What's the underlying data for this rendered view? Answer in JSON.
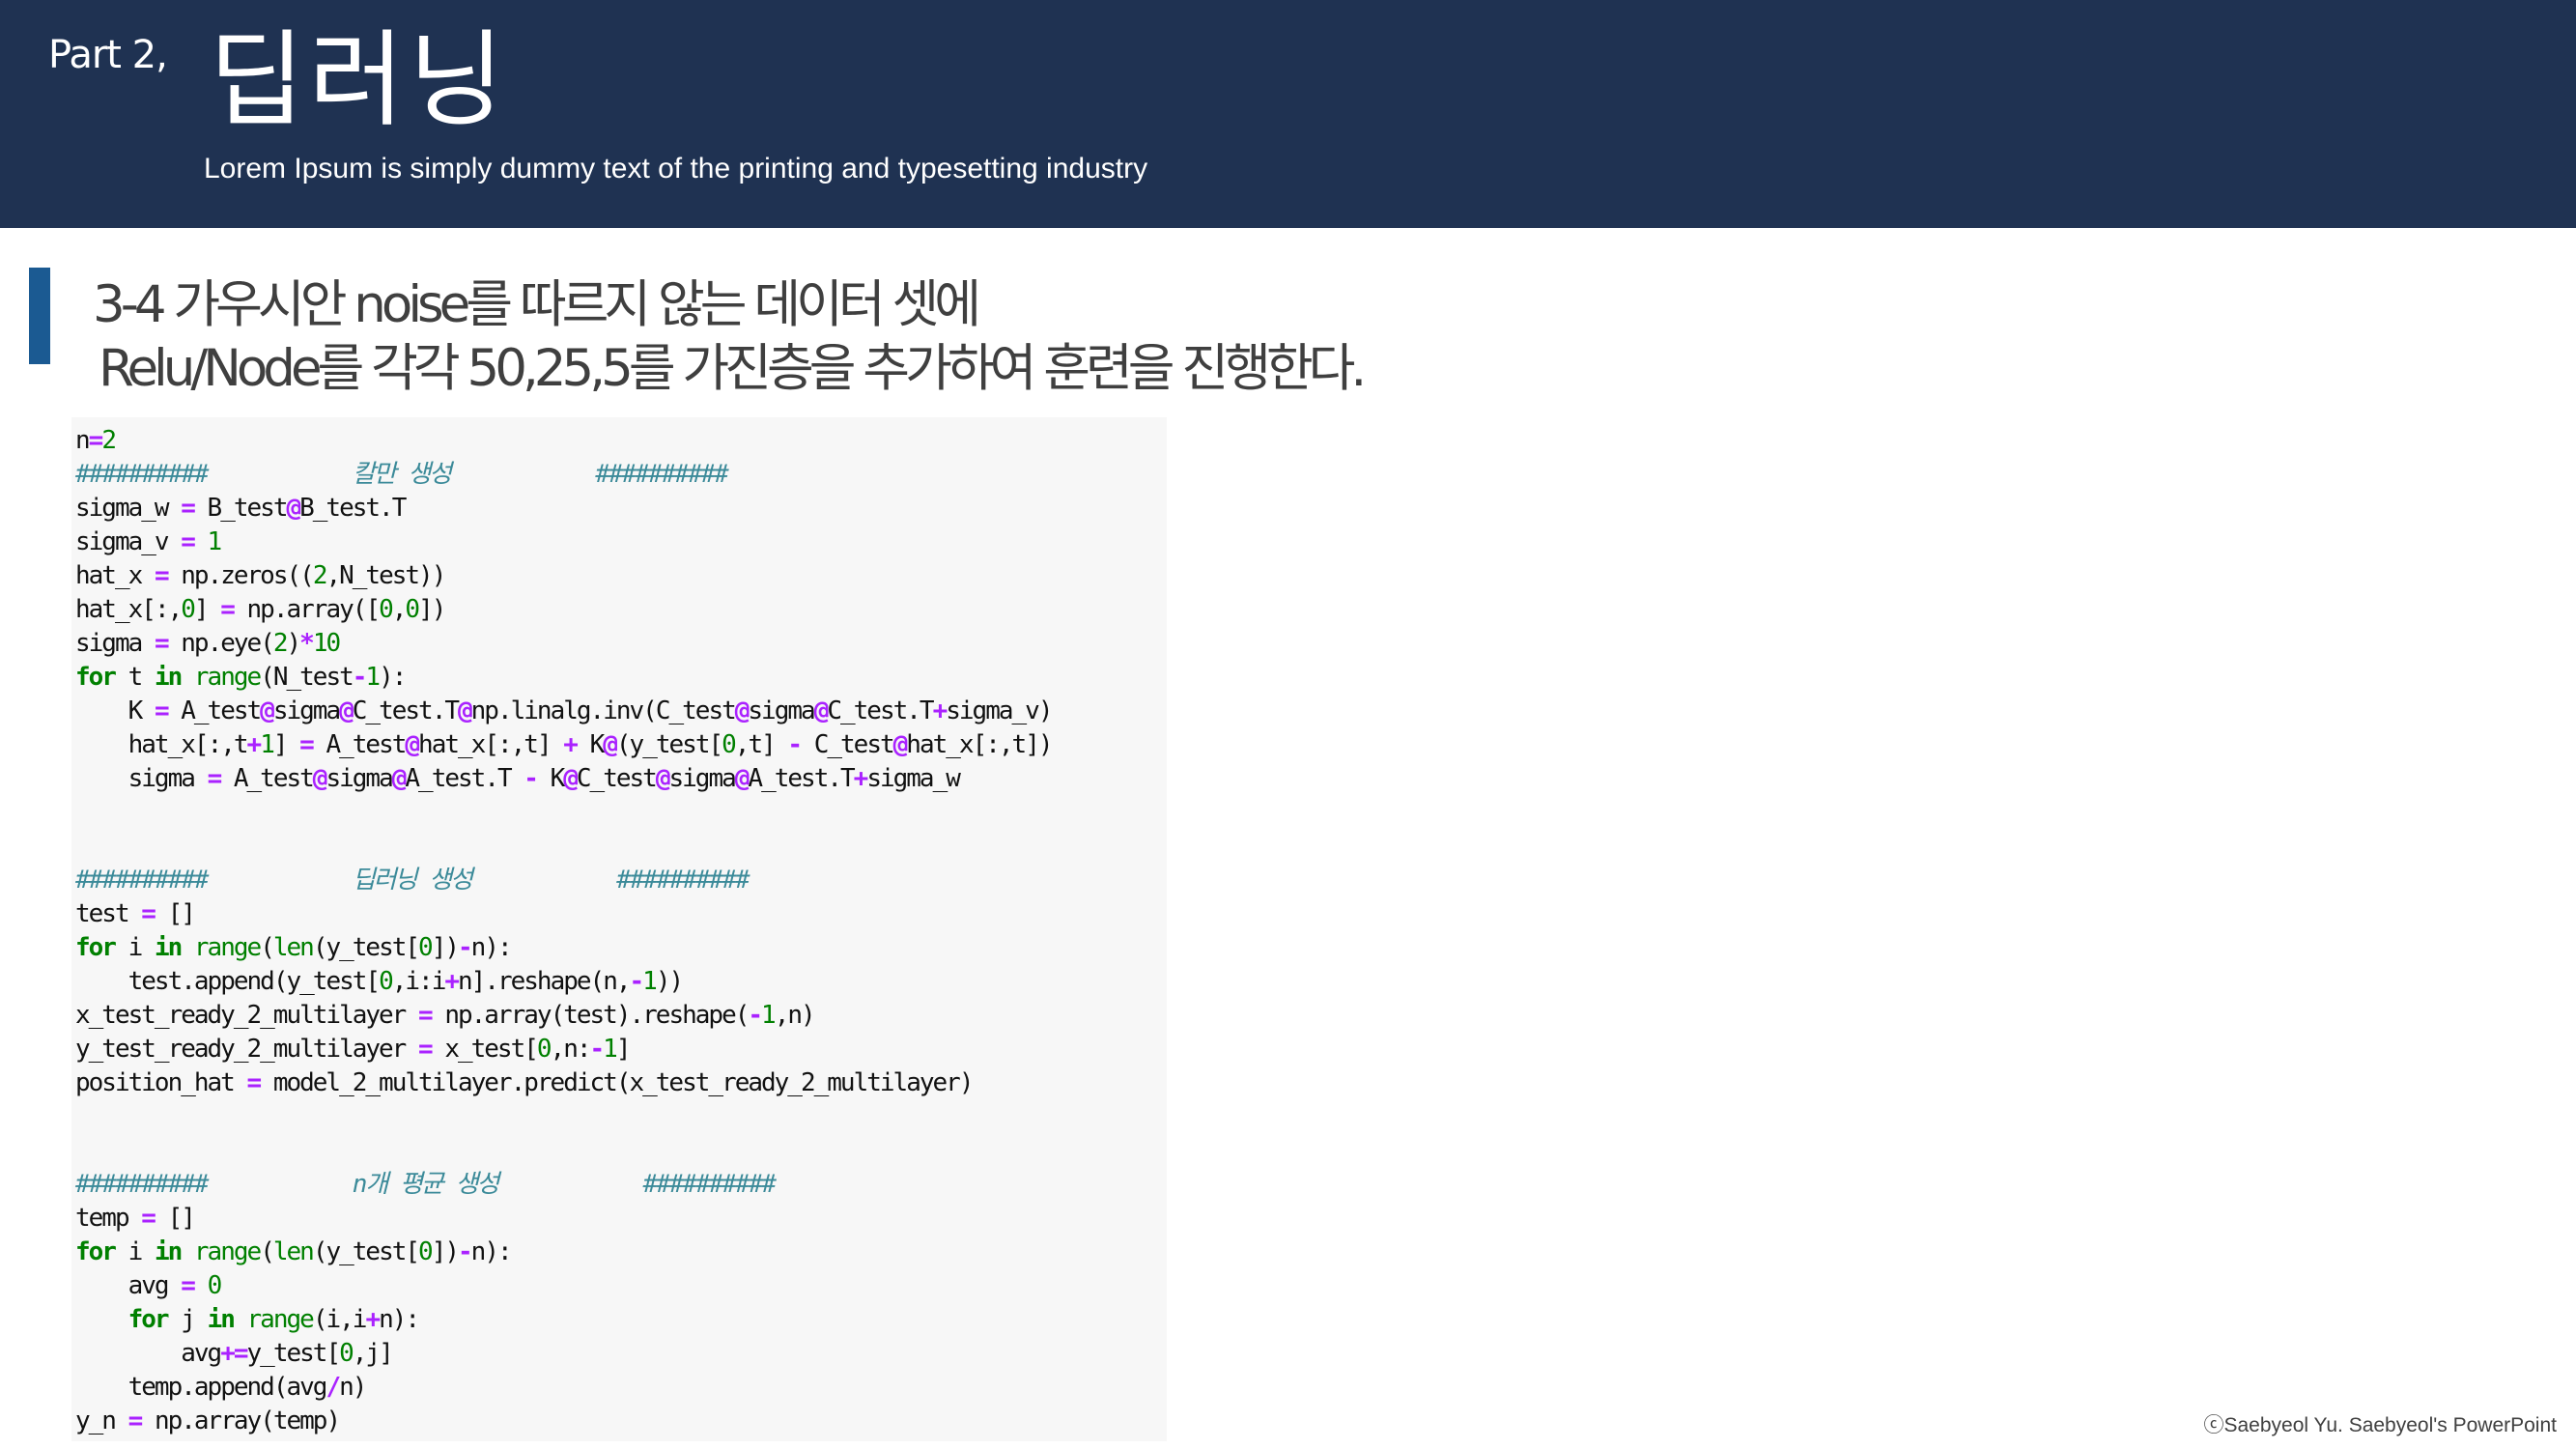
{
  "header": {
    "part_label": "Part 2,",
    "title": "딥러닝",
    "subtitle": "Lorem Ipsum is simply dummy text of the printing and typesetting industry"
  },
  "colors": {
    "header_bg": "#1f3252",
    "accent_bar": "#1b5a92",
    "code_bg": "#f7f7f7",
    "keyword": "#008000",
    "operator": "#aa22ff",
    "comment": "#3b8a99"
  },
  "heading": {
    "line1": "3-4 가우시안 noise를 따르지 않는 데이터 셋에",
    "line2": "Relu/Node를 각각 50,25,5를 가진층을 추가하여 훈련을 진행한다."
  },
  "code": {
    "lines": [
      "n=2",
      "##########           칼만 생성           ##########",
      "sigma_w = B_test@B_test.T",
      "sigma_v = 1",
      "hat_x = np.zeros((2,N_test))",
      "hat_x[:,0] = np.array([0,0])",
      "sigma = np.eye(2)*10",
      "for t in range(N_test-1):",
      "    K = A_test@sigma@C_test.T@np.linalg.inv(C_test@sigma@C_test.T+sigma_v)",
      "    hat_x[:,t+1] = A_test@hat_x[:,t] + K@(y_test[0,t] - C_test@hat_x[:,t])",
      "    sigma = A_test@sigma@A_test.T - K@C_test@sigma@A_test.T+sigma_w",
      "",
      "",
      "##########           딥러닝 생성           ##########",
      "test = []",
      "for i in range(len(y_test[0])-n):",
      "    test.append(y_test[0,i:i+n].reshape(n,-1))",
      "x_test_ready_2_multilayer = np.array(test).reshape(-1,n)",
      "y_test_ready_2_multilayer = x_test[0,n:-1]",
      "position_hat = model_2_multilayer.predict(x_test_ready_2_multilayer)",
      "",
      "",
      "##########           n개 평균 생성           ##########",
      "temp = []",
      "for i in range(len(y_test[0])-n):",
      "    avg = 0",
      "    for j in range(i,i+n):",
      "        avg+=y_test[0,j]",
      "    temp.append(avg/n)",
      "y_n = np.array(temp)"
    ]
  },
  "footer": {
    "copyright": "ⓒSaebyeol Yu. Saebyeol's PowerPoint"
  }
}
